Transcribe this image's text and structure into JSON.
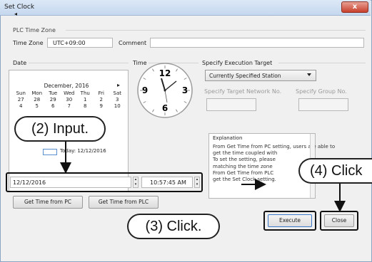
{
  "window": {
    "title": "Set Clock",
    "close": "x"
  },
  "timezone": {
    "group_label": "PLC Time Zone",
    "tz_label": "Time Zone",
    "tz_value": "UTC+09:00",
    "comment_label": "Comment"
  },
  "date_label": "Date",
  "time_label": "Time",
  "calendar": {
    "month": "December, 2016",
    "prev": "◂",
    "next": "▸",
    "weekdays": [
      "Sun",
      "Mon",
      "Tue",
      "Wed",
      "Thu",
      "Fri",
      "Sat"
    ],
    "week1": [
      "27",
      "28",
      "29",
      "30",
      "1",
      "2",
      "3"
    ],
    "week2": [
      "4",
      "5",
      "6",
      "7",
      "8",
      "9",
      "10"
    ],
    "today_text": "Today: 12/12/2016"
  },
  "clock": {
    "n12": "12",
    "n3": "3",
    "n6": "6",
    "n9": "9"
  },
  "inputs": {
    "date_value": "12/12/2016",
    "time_value": "10:57:45 AM"
  },
  "buttons": {
    "get_time_pc": "Get Time from PC",
    "get_time_plc": "Get Time from PLC",
    "execute": "Execute",
    "close": "Close"
  },
  "target": {
    "group_label": "Specify Execution Target",
    "selected": "Currently Specified Station",
    "network_label": "Specify Target Network No.",
    "group_no_label": "Specify Group No."
  },
  "explanation": {
    "label": "Explanation",
    "lines": [
      "From Get Time from PC setting, users are able to",
      "get the time coupled with",
      "To set the setting, please",
      "matching the time zone",
      "From Get Time from PLC",
      "get the Set Clock setting."
    ]
  },
  "callouts": {
    "input": "(2) Input.",
    "click3": "(3) Click.",
    "click4": "(4) Click"
  },
  "colors": {
    "accent": "#3c78c8",
    "title_bar": "#c5d8ef",
    "close_red": "#c8402c"
  }
}
